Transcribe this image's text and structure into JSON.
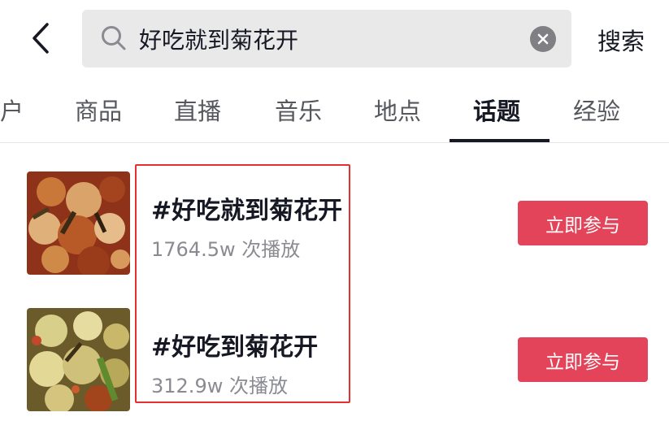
{
  "search": {
    "query": "好吃就到菊花开",
    "submit_label": "搜索"
  },
  "tabs": [
    {
      "label": "户",
      "active": false
    },
    {
      "label": "商品",
      "active": false
    },
    {
      "label": "直播",
      "active": false
    },
    {
      "label": "音乐",
      "active": false
    },
    {
      "label": "地点",
      "active": false
    },
    {
      "label": "话题",
      "active": true
    },
    {
      "label": "经验",
      "active": false
    }
  ],
  "results": [
    {
      "title": "#好吃就到菊花开",
      "plays": "1764.5w 次播放",
      "button_label": "立即参与"
    },
    {
      "title": "#好吃到菊花开",
      "plays": "312.9w 次播放",
      "button_label": "立即参与"
    }
  ],
  "colors": {
    "accent": "#e4445a",
    "highlight": "#e5302f",
    "text": "#161823",
    "muted": "#8a8b91",
    "search_bg": "#e9e9ea"
  },
  "icons": {
    "back": "chevron-left-icon",
    "search": "search-icon",
    "clear": "clear-icon"
  }
}
